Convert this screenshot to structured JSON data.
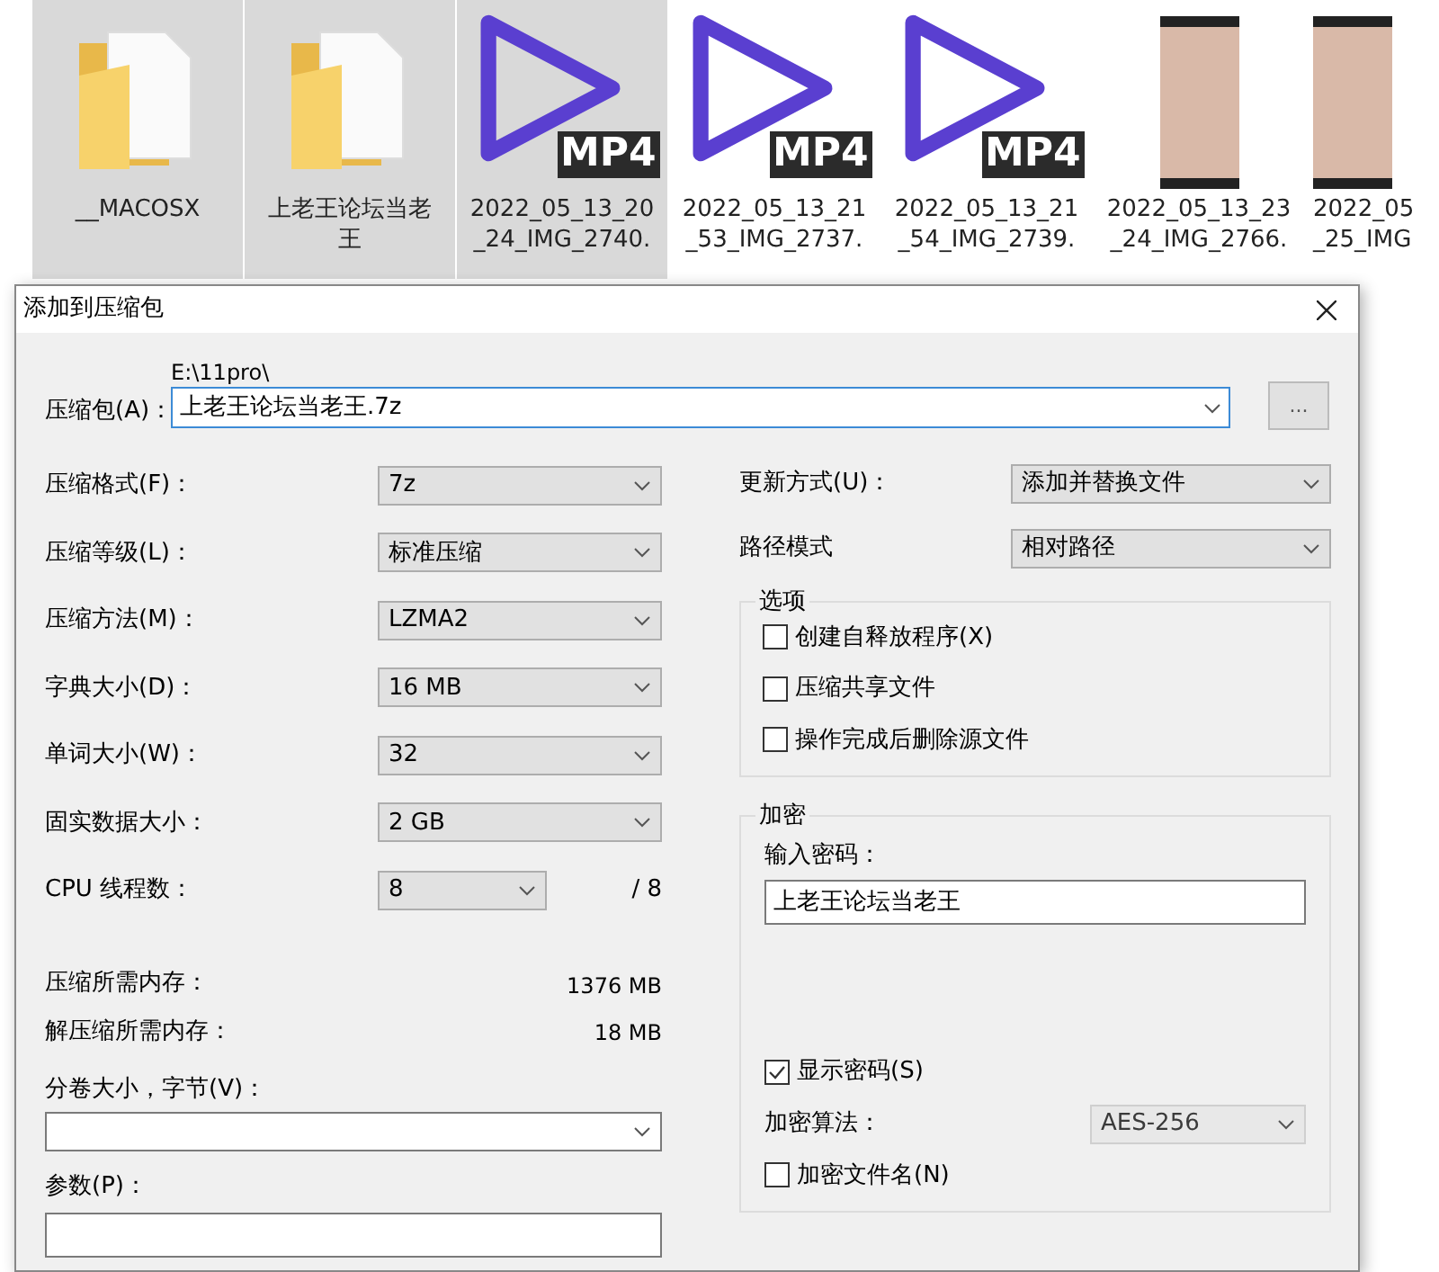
{
  "files": [
    {
      "kind": "folder",
      "lines": [
        "__MACOSX"
      ],
      "selected": true
    },
    {
      "kind": "folder",
      "lines": [
        "上老王论坛当老",
        "王"
      ],
      "selected": true
    },
    {
      "kind": "video",
      "badge": "MP4",
      "lines": [
        "2022_05_13_20",
        "_24_IMG_2740."
      ],
      "selected": true
    },
    {
      "kind": "video",
      "badge": "MP4",
      "lines": [
        "2022_05_13_21",
        "_53_IMG_2737."
      ],
      "selected": false
    },
    {
      "kind": "video",
      "badge": "MP4",
      "lines": [
        "2022_05_13_21",
        "_54_IMG_2739."
      ],
      "selected": false
    },
    {
      "kind": "image",
      "lines": [
        "2022_05_13_23",
        "_24_IMG_2766."
      ],
      "selected": false
    },
    {
      "kind": "image",
      "lines": [
        "2022_05",
        "_25_IMG"
      ],
      "selected": false
    }
  ],
  "dialog": {
    "title": "添加到压缩包",
    "archive": {
      "label": "压缩包(A)：",
      "path": "E:\\11pro\\",
      "value": "上老王论坛当老王.7z",
      "browse": "..."
    },
    "left_fields": [
      {
        "kind": "select",
        "label": "压缩格式(F)：",
        "value": "7z"
      },
      {
        "kind": "select",
        "label": "压缩等级(L)：",
        "value": "标准压缩"
      },
      {
        "kind": "select",
        "label": "压缩方法(M)：",
        "value": "LZMA2"
      },
      {
        "kind": "select",
        "label": "字典大小(D)：",
        "value": "16 MB"
      },
      {
        "kind": "select",
        "label": "单词大小(W)：",
        "value": "32"
      },
      {
        "kind": "select",
        "label": "固实数据大小：",
        "value": "2 GB"
      },
      {
        "kind": "select_small",
        "label": "CPU 线程数：",
        "value": "8",
        "suffix": "/ 8"
      },
      {
        "kind": "info",
        "label": "压缩所需内存：",
        "value": "1376 MB"
      },
      {
        "kind": "info",
        "label": "解压缩所需内存：",
        "value": "18 MB"
      }
    ],
    "volume": {
      "label": "分卷大小，字节(V)："
    },
    "parameters": {
      "label": "参数(P)："
    },
    "right_fields": [
      {
        "label": "更新方式(U)：",
        "value": "添加并替换文件"
      },
      {
        "label": "路径模式",
        "value": "相对路径"
      }
    ],
    "options": {
      "title": "选项",
      "items": [
        {
          "label": "创建自释放程序(X)",
          "checked": false
        },
        {
          "label": "压缩共享文件",
          "checked": false
        },
        {
          "label": "操作完成后删除源文件",
          "checked": false
        }
      ]
    },
    "encryption": {
      "title": "加密",
      "password_label": "输入密码：",
      "password": "上老王论坛当老王",
      "show_password": {
        "label": "显示密码(S)",
        "checked": true
      },
      "method": {
        "label": "加密算法：",
        "value": "AES-256",
        "disabled": true
      },
      "encrypt_names": {
        "label": "加密文件名(N)",
        "checked": false
      }
    }
  }
}
